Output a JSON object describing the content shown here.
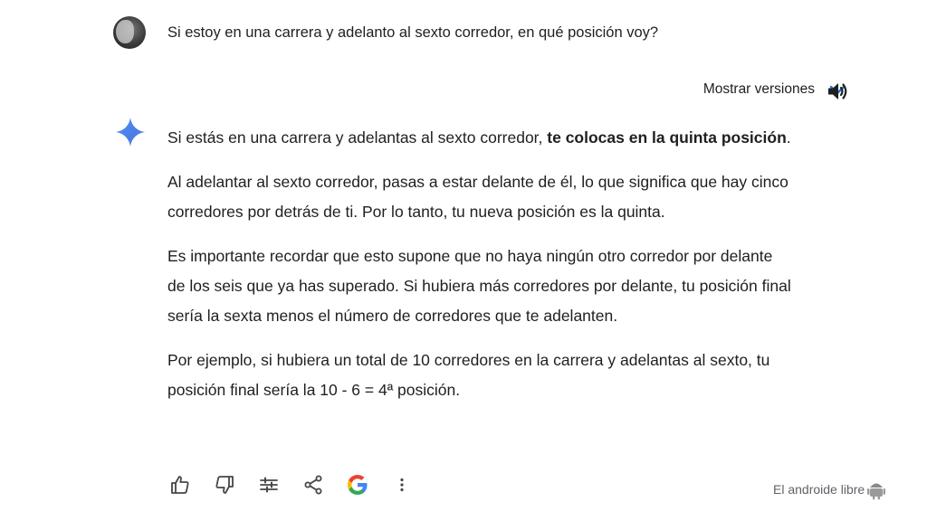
{
  "user": {
    "avatar": "avatar",
    "message": "Si estoy en una carrera y adelanto al sexto corredor, en qué posición voy?"
  },
  "versions": {
    "label": "Mostrar versiones",
    "icon": "chevron-down-icon"
  },
  "speaker_icon": "volume-icon",
  "assistant_icon": "gemini-sparkle-icon",
  "response": {
    "p1_before": "Si estás en una carrera y adelantas al sexto corredor, ",
    "p1_bold": "te colocas en la quinta posición",
    "p1_after": ".",
    "p2": "Al adelantar al sexto corredor, pasas a estar delante de él, lo que significa que hay cinco corredores por detrás de ti. Por lo tanto, tu nueva posición es la quinta.",
    "p3": "Es importante recordar que esto supone que no haya ningún otro corredor por delante de los seis que ya has superado. Si hubiera más corredores por delante, tu posición final sería la sexta menos el número de corredores que te adelanten.",
    "p4": "Por ejemplo, si hubiera un total de 10 corredores en la carrera y adelantas al sexto, tu posición final sería la 10 - 6 = 4ª posición."
  },
  "actions": {
    "thumbs_up": "thumbs-up-icon",
    "thumbs_down": "thumbs-down-icon",
    "modify": "tune-icon",
    "share": "share-icon",
    "google": "google-g-icon",
    "more": "more-vert-icon"
  },
  "watermark": {
    "text": "El androide libre"
  },
  "colors": {
    "accent_blue": "#1a73e8",
    "text": "#1f1f1f",
    "icon": "#444746"
  }
}
